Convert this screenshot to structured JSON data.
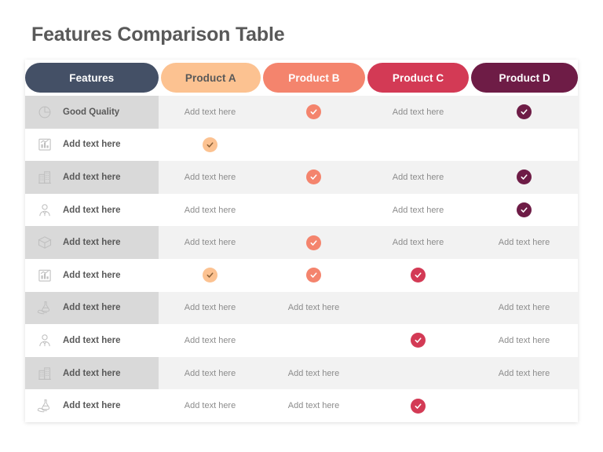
{
  "page_title": "Features Comparison Table",
  "colors": {
    "features_header_bg": "#445066",
    "product_a": "#FCC291",
    "product_b": "#F4846D",
    "product_c": "#D33A55",
    "product_d": "#6E1C46",
    "row_odd_bg": "#F2F2F2",
    "row_even_bg": "#FFFFFF",
    "feature_col_odd_bg": "#D9D9D9",
    "title_text": "#595959",
    "body_text": "#8C8C8C",
    "icon_gray": "#BFBFBF"
  },
  "headers": [
    {
      "label": "Features",
      "bg": "#445066",
      "fg": "#FFFFFF"
    },
    {
      "label": "Product A",
      "bg": "#FCC291",
      "fg": "#595959"
    },
    {
      "label": "Product B",
      "bg": "#F4846D",
      "fg": "#FFFFFF"
    },
    {
      "label": "Product C",
      "bg": "#D33A55",
      "fg": "#FFFFFF"
    },
    {
      "label": "Product D",
      "bg": "#6E1C46",
      "fg": "#FFFFFF"
    }
  ],
  "check_styles": {
    "a": {
      "bg": "#FCC291",
      "tick": "#8C6239"
    },
    "b": {
      "bg": "#F4846D",
      "tick": "#FFFFFF"
    },
    "c": {
      "bg": "#D33A55",
      "tick": "#FFFFFF"
    },
    "d": {
      "bg": "#6E1C46",
      "tick": "#FFFFFF"
    }
  },
  "placeholder_text": "Add text here",
  "rows": [
    {
      "icon": "pie-chart-icon",
      "label": "Good Quality",
      "cells": [
        {
          "type": "text",
          "value": "Add text here"
        },
        {
          "type": "check",
          "style": "b"
        },
        {
          "type": "text",
          "value": "Add text here"
        },
        {
          "type": "check",
          "style": "d"
        }
      ]
    },
    {
      "icon": "bar-chart-icon",
      "label": "Add text here",
      "cells": [
        {
          "type": "check",
          "style": "a"
        },
        {
          "type": "empty"
        },
        {
          "type": "empty"
        },
        {
          "type": "empty"
        }
      ]
    },
    {
      "icon": "building-icon",
      "label": "Add text here",
      "cells": [
        {
          "type": "text",
          "value": "Add text here"
        },
        {
          "type": "check",
          "style": "b"
        },
        {
          "type": "text",
          "value": "Add text here"
        },
        {
          "type": "check",
          "style": "d"
        }
      ]
    },
    {
      "icon": "person-icon",
      "label": "Add text here",
      "cells": [
        {
          "type": "text",
          "value": "Add text here"
        },
        {
          "type": "empty"
        },
        {
          "type": "text",
          "value": "Add text here"
        },
        {
          "type": "check",
          "style": "d"
        }
      ]
    },
    {
      "icon": "open-box-icon",
      "label": "Add text here",
      "cells": [
        {
          "type": "text",
          "value": "Add text here"
        },
        {
          "type": "check",
          "style": "b"
        },
        {
          "type": "text",
          "value": "Add text here"
        },
        {
          "type": "text",
          "value": "Add text here"
        }
      ]
    },
    {
      "icon": "bar-chart-icon",
      "label": "Add text here",
      "cells": [
        {
          "type": "check",
          "style": "a"
        },
        {
          "type": "check",
          "style": "b"
        },
        {
          "type": "check",
          "style": "c"
        },
        {
          "type": "empty"
        }
      ]
    },
    {
      "icon": "hand-flask-icon",
      "label": "Add text here",
      "cells": [
        {
          "type": "text",
          "value": "Add text here"
        },
        {
          "type": "text",
          "value": "Add text here"
        },
        {
          "type": "empty"
        },
        {
          "type": "text",
          "value": "Add text here"
        }
      ]
    },
    {
      "icon": "person-icon",
      "label": "Add text here",
      "cells": [
        {
          "type": "text",
          "value": "Add text here"
        },
        {
          "type": "empty"
        },
        {
          "type": "check",
          "style": "c"
        },
        {
          "type": "text",
          "value": "Add text here"
        }
      ]
    },
    {
      "icon": "building-icon",
      "label": "Add text here",
      "cells": [
        {
          "type": "text",
          "value": "Add text here"
        },
        {
          "type": "text",
          "value": "Add text here"
        },
        {
          "type": "empty"
        },
        {
          "type": "text",
          "value": "Add text here"
        }
      ]
    },
    {
      "icon": "hand-flask-icon",
      "label": "Add text here",
      "cells": [
        {
          "type": "text",
          "value": "Add text here"
        },
        {
          "type": "text",
          "value": "Add text here"
        },
        {
          "type": "check",
          "style": "c"
        },
        {
          "type": "empty"
        }
      ]
    }
  ]
}
